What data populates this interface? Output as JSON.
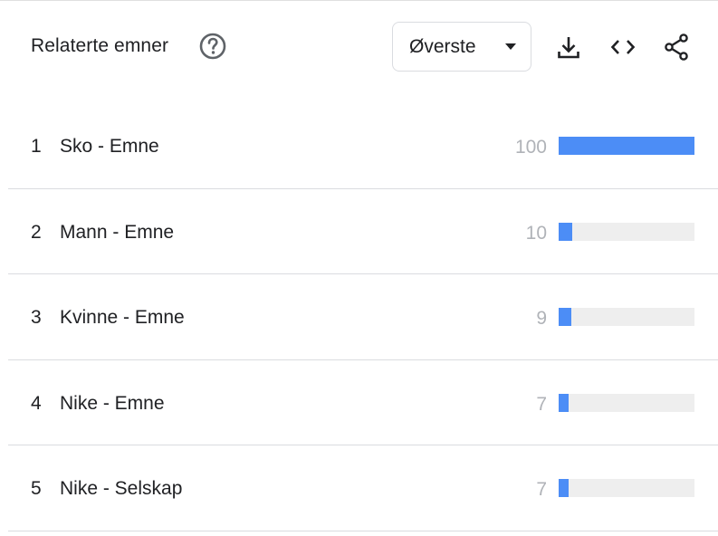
{
  "header": {
    "title": "Relaterte emner",
    "help_icon": "help-circle-icon",
    "dropdown": {
      "selected": "Øverste",
      "caret_icon": "caret-down-icon"
    },
    "actions": [
      "download-icon",
      "embed-code-icon",
      "share-icon"
    ]
  },
  "colors": {
    "bar": "#4c8df6",
    "track": "#eeeeee",
    "value_text": "#b0b3b8",
    "icon": "#5f6368"
  },
  "rows": [
    {
      "rank": "1",
      "label": "Sko - Emne",
      "value": "100",
      "fraction": 1.0
    },
    {
      "rank": "2",
      "label": "Mann - Emne",
      "value": "10",
      "fraction": 0.1
    },
    {
      "rank": "3",
      "label": "Kvinne - Emne",
      "value": "9",
      "fraction": 0.09
    },
    {
      "rank": "4",
      "label": "Nike - Emne",
      "value": "7",
      "fraction": 0.07
    },
    {
      "rank": "5",
      "label": "Nike - Selskap",
      "value": "7",
      "fraction": 0.07
    }
  ]
}
